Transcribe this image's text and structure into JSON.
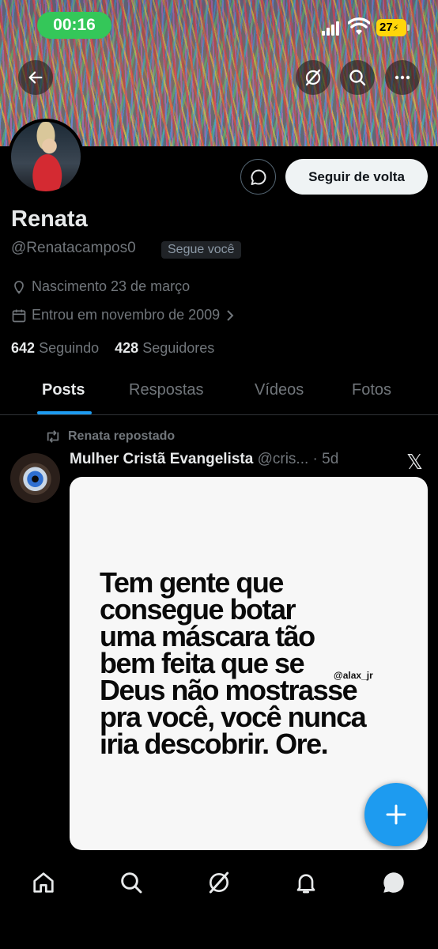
{
  "status_bar": {
    "time": "00:16",
    "battery": "27"
  },
  "profile": {
    "name": "Renata",
    "handle": "@Renatacampos0",
    "follows_you_badge": "Segue você",
    "birth": "Nascimento 23 de março",
    "joined": "Entrou em novembro de 2009",
    "following_count": "642",
    "following_label": "Seguindo",
    "followers_count": "428",
    "followers_label": "Seguidores",
    "follow_back_label": "Seguir de volta"
  },
  "tabs": [
    {
      "label": "Posts",
      "active": true
    },
    {
      "label": "Respostas",
      "active": false
    },
    {
      "label": "Vídeos",
      "active": false
    },
    {
      "label": "Fotos",
      "active": false
    }
  ],
  "post": {
    "repost_label": "Renata repostado",
    "author": "Mulher Cristã Evangelista",
    "author_handle": "@cris...",
    "time": "· 5d",
    "image_text": [
      "Tem gente que",
      "consegue botar",
      "uma máscara tão",
      "bem feita que se",
      "Deus não mostrasse",
      "pra você, você nunca",
      "iria descobrir. Ore."
    ],
    "image_credit": "@alax_jr"
  },
  "colors": {
    "accent": "#1d9bf0",
    "status_pill": "#34c759",
    "battery": "#ffd60a",
    "background": "#000000"
  },
  "icons": {
    "back": "arrow-left-icon",
    "grok": "grok-icon",
    "search": "search-icon",
    "more": "more-icon",
    "message": "message-icon",
    "location": "location-pin-icon",
    "calendar": "calendar-icon",
    "repost": "repost-icon",
    "x_logo": "x-logo-icon",
    "compose": "plus-icon",
    "nav": [
      "home-icon",
      "search-icon",
      "grok-icon",
      "bell-icon",
      "chat-icon"
    ]
  }
}
